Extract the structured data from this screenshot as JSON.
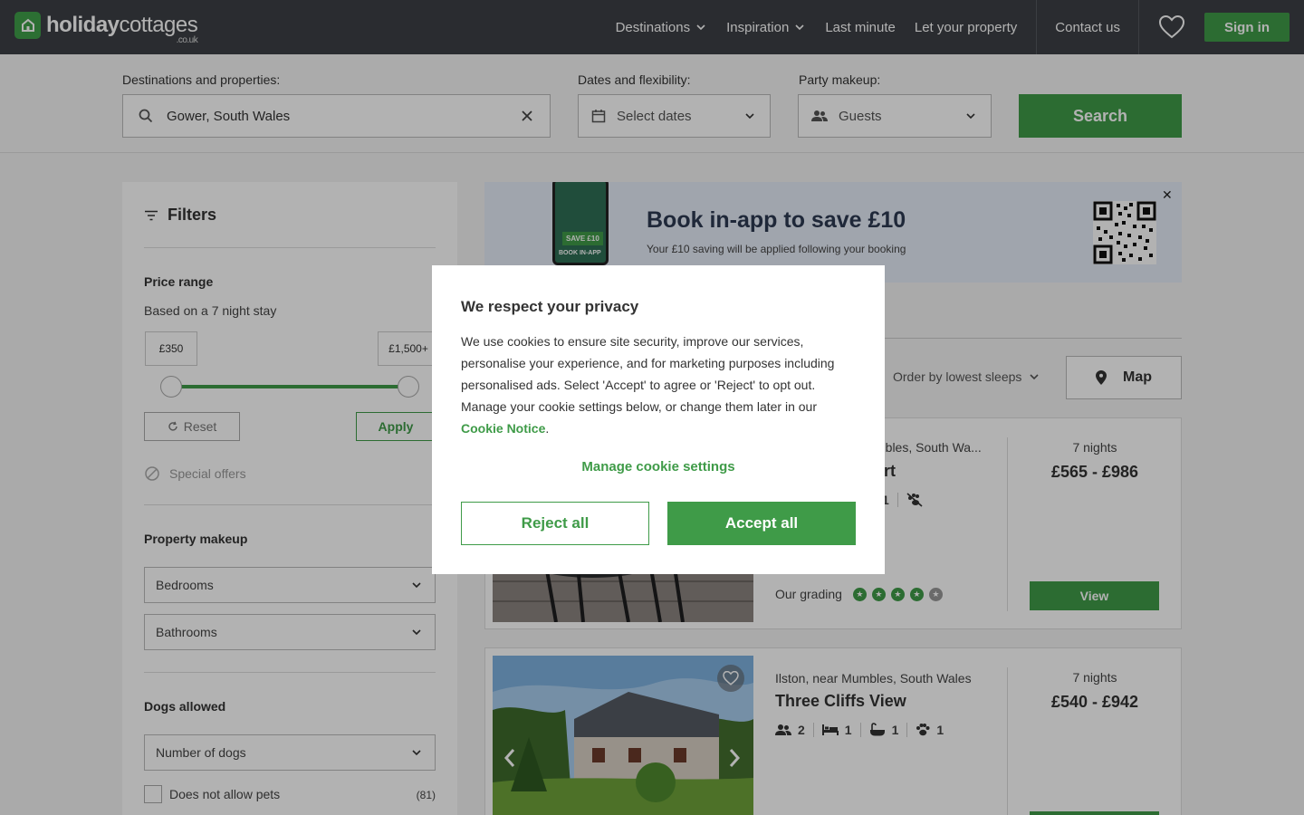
{
  "header": {
    "logo_main": "holiday",
    "logo_rest": "cottages",
    "logo_sub": ".co.uk",
    "nav": [
      "Destinations",
      "Inspiration",
      "Last minute",
      "Let your property",
      "Contact us"
    ],
    "signin": "Sign in"
  },
  "search": {
    "dest_label": "Destinations and properties:",
    "dest_value": "Gower, South Wales",
    "dates_label": "Dates and flexibility:",
    "dates_value": "Select dates",
    "party_label": "Party makeup:",
    "party_value": "Guests",
    "button": "Search"
  },
  "filters": {
    "title": "Filters",
    "price_range": "Price range",
    "price_note": "Based on a 7 night stay",
    "price_min": "£350",
    "price_max": "£1,500+",
    "reset": "Reset",
    "apply": "Apply",
    "special_offers": "Special offers",
    "property_makeup": "Property makeup",
    "bedrooms": "Bedrooms",
    "bathrooms": "Bathrooms",
    "dogs_allowed": "Dogs allowed",
    "number_of_dogs": "Number of dogs",
    "no_pets": "Does not allow pets",
    "no_pets_count": "(81)"
  },
  "banner": {
    "title": "Book in-app to save £10",
    "subtitle": "Your £10 saving will be applied following your booking",
    "badge": "SAVE £10",
    "phone_caption": "BOOK IN-APP",
    "close": "✕"
  },
  "results": {
    "order": "Order by lowest sleeps",
    "map": "Map",
    "cards": [
      {
        "location": "mbles, South Wa...",
        "name": "rt",
        "facts": [
          "1"
        ],
        "nights": "7 nights",
        "price": "£565 - £986",
        "view": "View",
        "grading_label": "Our grading"
      },
      {
        "location": "Ilston, near Mumbles, South Wales",
        "name": "Three Cliffs View",
        "facts": [
          "2",
          "1",
          "1",
          "1"
        ],
        "nights": "7 nights",
        "price": "£540 - £942"
      }
    ]
  },
  "cookie": {
    "title": "We respect your privacy",
    "body": "We use cookies to ensure site security, improve our services, personalise your experience, and for marketing purposes including personalised ads. Select 'Accept' to agree or 'Reject' to opt out. Manage your cookie settings below, or change them later in our ",
    "link": "Cookie Notice",
    "link_after": ".",
    "manage": "Manage cookie settings",
    "reject": "Reject all",
    "accept": "Accept all"
  },
  "colors": {
    "brand_green": "#3f9b48",
    "header_bg": "#3d4045"
  }
}
